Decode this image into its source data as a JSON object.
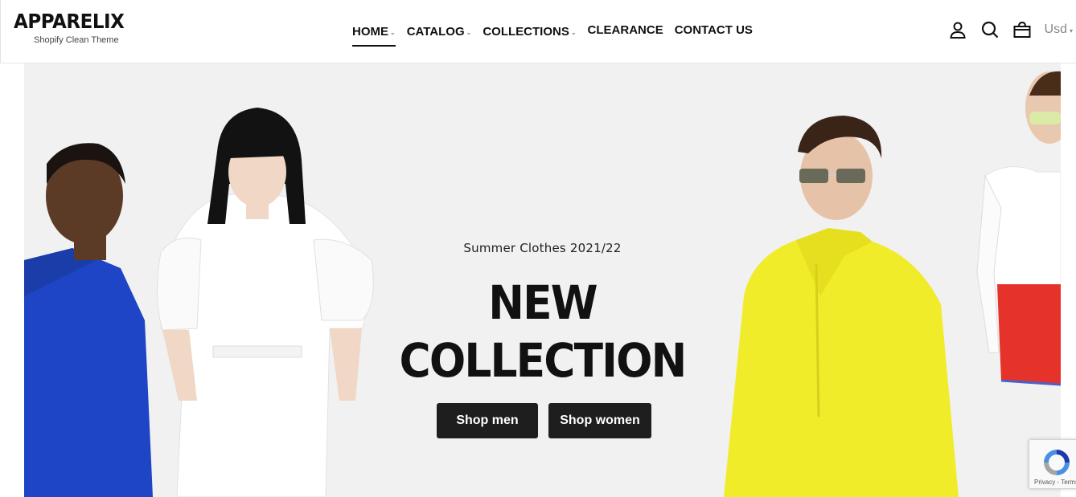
{
  "brand": {
    "name": "APPARELIX",
    "tagline": "Shopify Clean Theme"
  },
  "nav": {
    "items": [
      {
        "label": "HOME",
        "has_dropdown": true,
        "active": true
      },
      {
        "label": "CATALOG",
        "has_dropdown": true,
        "active": false
      },
      {
        "label": "COLLECTIONS",
        "has_dropdown": true,
        "active": false
      },
      {
        "label": "CLEARANCE",
        "has_dropdown": false,
        "active": false
      },
      {
        "label": "CONTACT US",
        "has_dropdown": false,
        "active": false
      }
    ]
  },
  "header_icons": [
    "account-icon",
    "search-icon",
    "cart-icon"
  ],
  "currency": {
    "selected": "Usd"
  },
  "hero": {
    "subtitle": "Summer Clothes 2021/22",
    "title_line1": "NEW",
    "title_line2": "COLLECTION",
    "buttons": {
      "men": "Shop men",
      "women": "Shop women"
    }
  },
  "recaptcha": {
    "footer": "Privacy - Terms"
  },
  "colors": {
    "accent": "#111111",
    "button_bg": "#1e1e1e",
    "hero_bg": "#f1f1f1",
    "blue_jacket": "#1e45c6",
    "yellow_jacket": "#f1ec2a",
    "red_shorts": "#e5322a"
  }
}
